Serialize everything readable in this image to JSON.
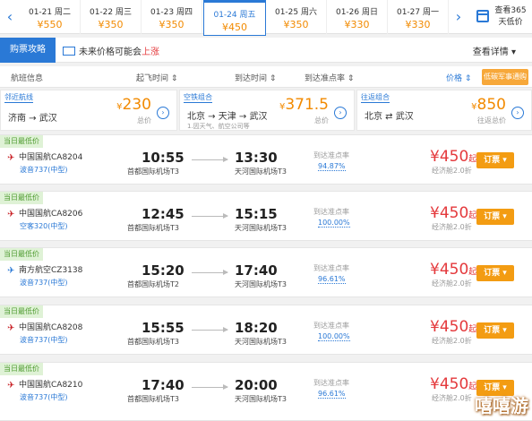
{
  "date_bar": {
    "prev_arrow": "‹",
    "next_arrow": "›",
    "dates": [
      {
        "date": "01-21 周二",
        "price": "¥550"
      },
      {
        "date": "01-22 周三",
        "price": "¥350"
      },
      {
        "date": "01-23 周四",
        "price": "¥350"
      },
      {
        "date": "01-24 周五",
        "price": "¥450"
      },
      {
        "date": "01-25 周六",
        "price": "¥350"
      },
      {
        "date": "01-26 周日",
        "price": "¥330"
      },
      {
        "date": "01-27 周一",
        "price": "¥330"
      }
    ],
    "calendar_label": "查看365天低价"
  },
  "tabs": {
    "active": "购票攻略",
    "trend_text": "未来价格可能会",
    "trend_up": "上涨",
    "details": "查看详情 ▾"
  },
  "column_header": {
    "flight_info": "航班信息",
    "depart_time": "起飞时间 ⇕",
    "arrive_time": "到达时间 ⇕",
    "ontime_rate": "到达准点率 ⇕",
    "price": "价格 ⇕",
    "notice": "低碳军事通购"
  },
  "combos": [
    {
      "tag": "邻近航线",
      "route": "济南 → 武汉",
      "sub": "",
      "price_symbol": "¥",
      "price": "230",
      "total": "总价"
    },
    {
      "tag": "空铁组合",
      "route": "北京 → 天津 → 武汉",
      "sub": "1.因天气、航空公司等",
      "price_symbol": "¥",
      "price": "371.5",
      "total": "总价"
    },
    {
      "tag": "往返组合",
      "route": "北京 ⇄ 武汉",
      "sub": "",
      "price_symbol": "¥",
      "price": "850",
      "total": "往返总价"
    }
  ],
  "flights": [
    {
      "badge": "当日最低价",
      "airline": "中国国航CA8204",
      "logo": "air-china",
      "plane": "波音737(中型)",
      "dep_time": "10:55",
      "dep_airport": "首都国际机场T3",
      "arr_time": "13:30",
      "arr_airport": "天河国际机场T3",
      "ontime_label": "到达准点率",
      "ontime": "94.87%",
      "price": "¥450",
      "price_suffix": "起",
      "cabin": "经济舱2.0折",
      "book": "订票 ▾"
    },
    {
      "badge": "当日最低价",
      "airline": "中国国航CA8206",
      "logo": "air-china",
      "plane": "空客320(中型)",
      "dep_time": "12:45",
      "dep_airport": "首都国际机场T3",
      "arr_time": "15:15",
      "arr_airport": "天河国际机场T3",
      "ontime_label": "到达准点率",
      "ontime": "100.00%",
      "price": "¥450",
      "price_suffix": "起",
      "cabin": "经济舱2.0折",
      "book": "订票 ▾"
    },
    {
      "badge": "当日最低价",
      "airline": "南方航空CZ3138",
      "logo": "china-southern",
      "plane": "波音737(中型)",
      "dep_time": "15:20",
      "dep_airport": "首都国际机场T2",
      "arr_time": "17:40",
      "arr_airport": "天河国际机场T3",
      "ontime_label": "到达准点率",
      "ontime": "96.61%",
      "price": "¥450",
      "price_suffix": "起",
      "cabin": "经济舱2.0折",
      "book": "订票 ▾"
    },
    {
      "badge": "当日最低价",
      "airline": "中国国航CA8208",
      "logo": "air-china",
      "plane": "波音737(中型)",
      "dep_time": "15:55",
      "dep_airport": "首都国际机场T3",
      "arr_time": "18:20",
      "arr_airport": "天河国际机场T3",
      "ontime_label": "到达准点率",
      "ontime": "100.00%",
      "price": "¥450",
      "price_suffix": "起",
      "cabin": "经济舱2.0折",
      "book": "订票 ▾"
    },
    {
      "badge": "当日最低价",
      "airline": "中国国航CA8210",
      "logo": "air-china",
      "plane": "波音737(中型)",
      "dep_time": "17:40",
      "dep_airport": "首都国际机场T3",
      "arr_time": "20:00",
      "arr_airport": "天河国际机场T3",
      "ontime_label": "到达准点率",
      "ontime": "96.61%",
      "price": "¥450",
      "price_suffix": "起",
      "cabin": "经济舱2.0折",
      "book": "订票 ▾"
    }
  ],
  "watermark": "嘻嘻游"
}
